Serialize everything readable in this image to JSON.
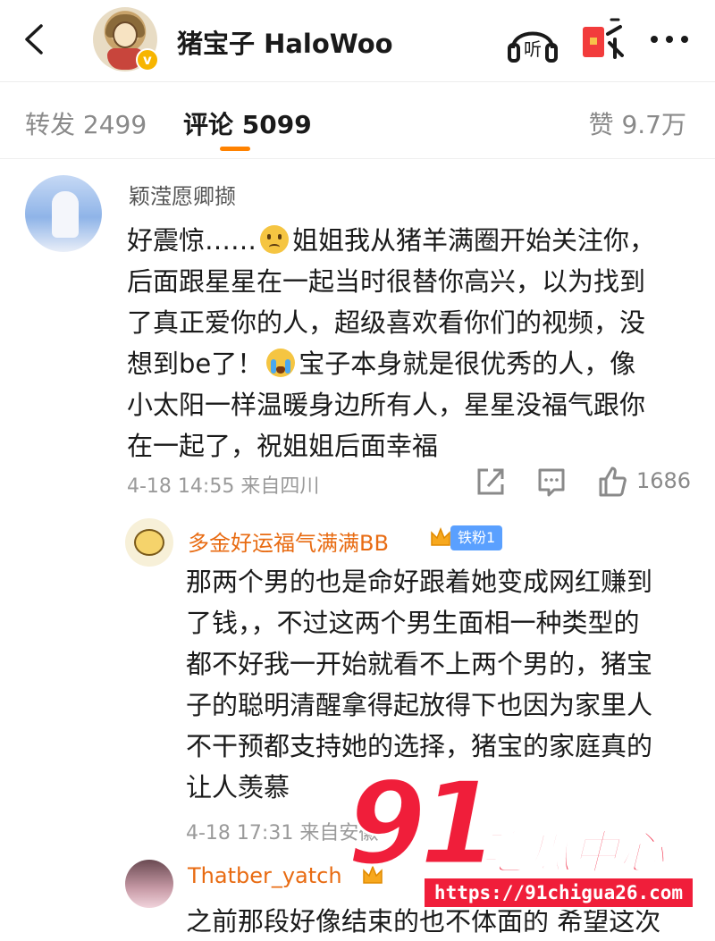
{
  "header": {
    "title": "猪宝子 HaloWoo",
    "listen_label": "听",
    "icons": [
      "back-icon",
      "listen-icon",
      "red-packet-icon",
      "more-icon"
    ]
  },
  "tabs": {
    "repost": "转发 2499",
    "comment": "评论 5099",
    "like": "赞 9.7万",
    "accent_color": "#ff8200"
  },
  "comments": [
    {
      "username": "颖滢愿卿撷",
      "lines": [
        {
          "a": "好震惊……",
          "b": "姐姐我从猪羊满圈开始关注你，"
        },
        {
          "a": "后面跟星星在一起当时很替你高兴，以为找到"
        },
        {
          "a": "了真正爱你的人，超级喜欢看你们的视频，没"
        },
        {
          "a": "想到be了！",
          "b": "宝子本身就是很优秀的人，像"
        },
        {
          "a": "小太阳一样温暖身边所有人，星星没福气跟你"
        },
        {
          "a": "在一起了，祝姐姐后面幸福"
        }
      ],
      "meta": "4-18 14:55  来自四川",
      "like_count": "1686"
    },
    {
      "username": "多金好运福气满满BB",
      "fan_badge": "铁粉1",
      "lines": [
        "那两个男的也是命好跟着她变成网红赚到",
        "了钱，，不过这两个男生面相一种类型的",
        "都不好我一开始就看不上两个男的，猪宝",
        "子的聪明清醒拿得起放得下也因为家里人",
        "不干预都支持她的选择，猪宝的家庭真的",
        "让人羡慕"
      ],
      "meta": "4-18 17:31  来自安徽"
    },
    {
      "username": "Thatber_yatch",
      "lines": [
        "之前那段好像结束的也不体面的 希望这次"
      ]
    }
  ],
  "watermark": {
    "number": "91",
    "name": "吃瓜中心",
    "url": "https://91chigua26.com"
  }
}
